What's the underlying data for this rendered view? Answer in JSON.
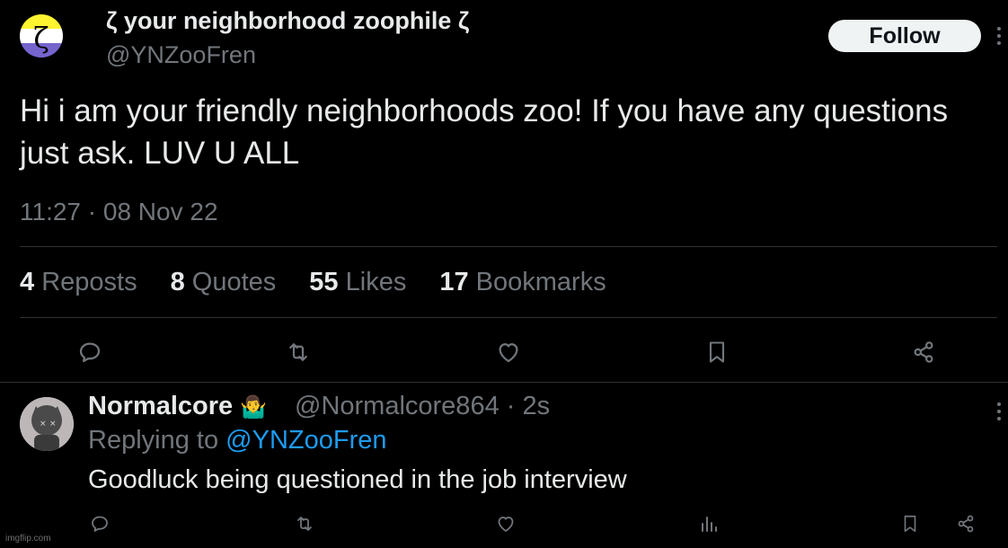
{
  "tweet": {
    "author": {
      "display_name": "ζ your neighborhood zoophile ζ",
      "handle": "@YNZooFren",
      "avatar_symbol": "ζ"
    },
    "follow_label": "Follow",
    "text": "Hi i am your friendly neighborhoods zoo! If you have any questions just ask. LUV U ALL",
    "timestamp": "11:27 · 08 Nov 22",
    "stats": {
      "reposts_count": "4",
      "reposts_label": "Reposts",
      "quotes_count": "8",
      "quotes_label": "Quotes",
      "likes_count": "55",
      "likes_label": "Likes",
      "bookmarks_count": "17",
      "bookmarks_label": "Bookmarks"
    },
    "actions": [
      "reply-icon",
      "repost-icon",
      "like-icon",
      "bookmark-icon",
      "share-icon"
    ]
  },
  "reply": {
    "display_name": "Normalcore",
    "emoji": "🤷‍♂️",
    "handle_time": "@Normalcore864 · 2s",
    "replying_prefix": "Replying to",
    "replying_to": "@YNZooFren",
    "text": "Goodluck being questioned in the job interview",
    "actions": [
      "reply-icon",
      "repost-icon",
      "like-icon",
      "views-icon",
      "bookmark-icon",
      "share-icon"
    ]
  },
  "watermark": "imgflip.com",
  "colors": {
    "background": "#000000",
    "text_primary": "#e7e9ea",
    "text_secondary": "#71767b",
    "link": "#1d9bf0",
    "divider": "#2f3336"
  }
}
